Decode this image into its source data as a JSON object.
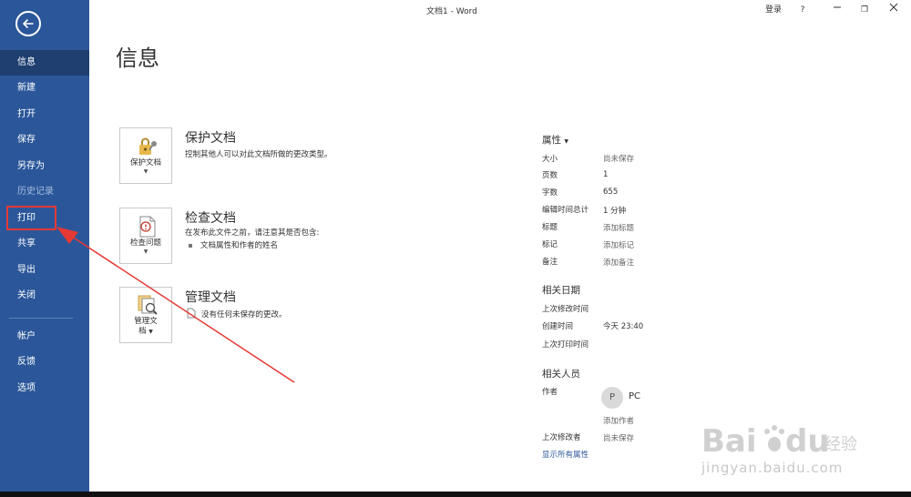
{
  "window": {
    "title": "文档1 - Word",
    "sign_in": "登录",
    "help": "?",
    "restore": "❐"
  },
  "sidebar": {
    "items": [
      {
        "label": "信息"
      },
      {
        "label": "新建"
      },
      {
        "label": "打开"
      },
      {
        "label": "保存"
      },
      {
        "label": "另存为"
      },
      {
        "label": "历史记录"
      },
      {
        "label": "打印"
      },
      {
        "label": "共享"
      },
      {
        "label": "导出"
      },
      {
        "label": "关闭"
      },
      {
        "label": "帐户"
      },
      {
        "label": "反馈"
      },
      {
        "label": "选项"
      }
    ]
  },
  "main": {
    "title": "信息",
    "cards": [
      {
        "button_label": "保护文档",
        "title": "保护文档",
        "desc": "控制其他人可以对此文档所做的更改类型。"
      },
      {
        "button_label": "检查问题",
        "title": "检查文档",
        "desc": "在发布此文件之前，请注意其是否包含:",
        "bullet": "文档属性和作者的姓名"
      },
      {
        "button_label_1": "管理文",
        "button_label_2": "档",
        "title": "管理文档",
        "desc": "没有任何未保存的更改。"
      }
    ]
  },
  "properties": {
    "header": "属性",
    "rows": [
      {
        "key": "大小",
        "value": "尚未保存"
      },
      {
        "key": "页数",
        "value": "1"
      },
      {
        "key": "字数",
        "value": "655"
      },
      {
        "key": "编辑时间总计",
        "value": "1 分钟"
      },
      {
        "key": "标题",
        "value": "添加标题"
      },
      {
        "key": "标记",
        "value": "添加标记"
      },
      {
        "key": "备注",
        "value": "添加备注"
      }
    ],
    "dates_header": "相关日期",
    "dates": [
      {
        "key": "上次修改时间",
        "value": ""
      },
      {
        "key": "创建时间",
        "value": "今天 23:40"
      },
      {
        "key": "上次打印时间",
        "value": ""
      }
    ],
    "people_header": "相关人员",
    "author_key": "作者",
    "author_initial": "P",
    "author_name": "PC",
    "add_author": "添加作者",
    "last_modified_by_key": "上次修改者",
    "last_modified_by_value": "尚未保存",
    "show_all": "显示所有属性"
  },
  "watermark": {
    "text": "jingyan.baidu.com"
  },
  "colors": {
    "sidebar": "#2b579a",
    "active": "#1e3f70",
    "annotation": "#e53935"
  }
}
